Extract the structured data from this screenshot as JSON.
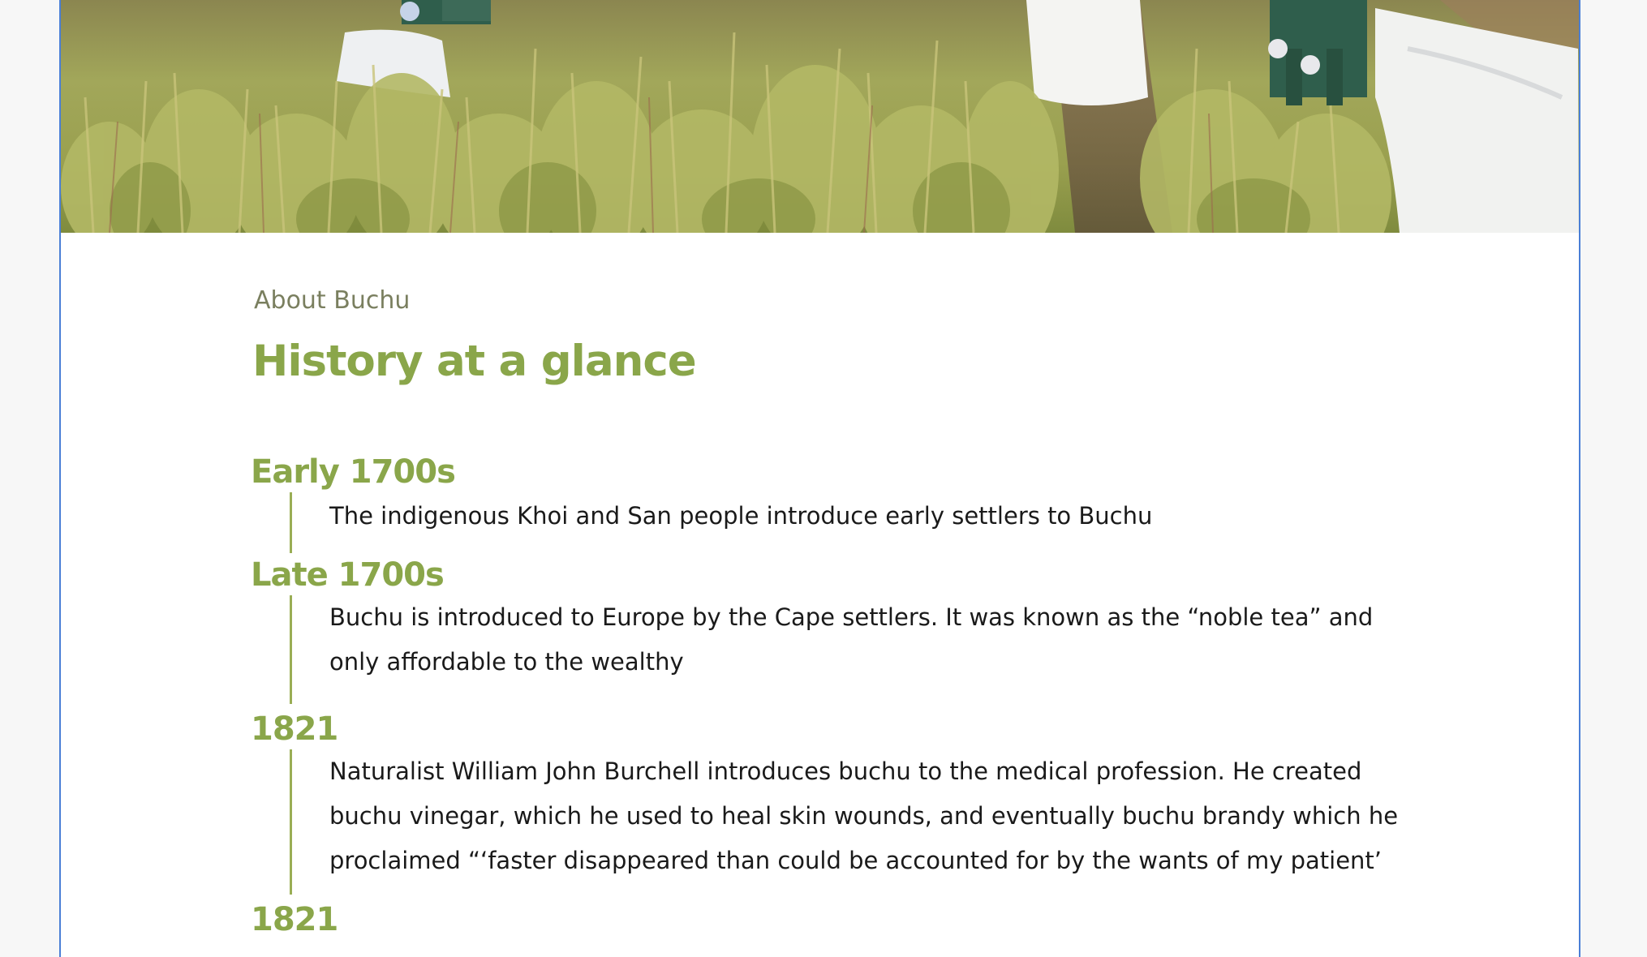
{
  "hero": {
    "alt_icon": "buchu-field-photo",
    "colors": {
      "sky": "#c9c2a3",
      "foliage_light": "#b8bd6a",
      "foliage_mid": "#9aa653",
      "foliage_dark": "#6f7a34",
      "bags": "#f2f2f0",
      "worker": "#2f5e4c"
    }
  },
  "section": {
    "eyebrow": "About Buchu",
    "title": "History at a glance"
  },
  "timeline": [
    {
      "year": "Early 1700s",
      "lines": [
        "The indigenous Khoi and San people introduce early settlers to Buchu"
      ]
    },
    {
      "year": "Late 1700s",
      "lines": [
        "Buchu is introduced to Europe by the Cape settlers. It was known as the “noble tea” and",
        "only affordable to the wealthy"
      ]
    },
    {
      "year": "1821",
      "lines": [
        "Naturalist William John Burchell introduces buchu to the medical profession. He created",
        "buchu vinegar, which he used to heal skin wounds, and eventually buchu brandy which he",
        "proclaimed “‘faster disappeared than could be accounted for by the wants of my patient’"
      ]
    },
    {
      "year": "1821",
      "lines": []
    }
  ],
  "colors": {
    "accent_green": "#8aa64a",
    "eyebrow_gray": "#7a7f5f",
    "frame_blue": "#4a7fd6"
  }
}
